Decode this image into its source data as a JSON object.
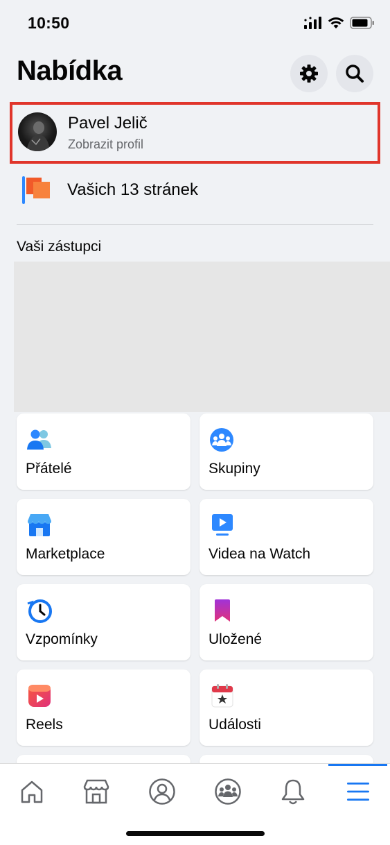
{
  "status_bar": {
    "time": "10:50"
  },
  "header": {
    "title": "Nabídka"
  },
  "profile": {
    "name": "Pavel Jelič",
    "subtitle": "Zobrazit profil"
  },
  "pages": {
    "label": "Vašich 13 stránek"
  },
  "shortcuts": {
    "title": "Vaši zástupci"
  },
  "tiles": [
    {
      "label": "Přátelé",
      "icon": "friends-icon"
    },
    {
      "label": "Skupiny",
      "icon": "groups-icon"
    },
    {
      "label": "Marketplace",
      "icon": "marketplace-icon"
    },
    {
      "label": "Videa na Watch",
      "icon": "watch-icon"
    },
    {
      "label": "Vzpomínky",
      "icon": "memories-icon"
    },
    {
      "label": "Uložené",
      "icon": "saved-icon"
    },
    {
      "label": "Reels",
      "icon": "reels-icon"
    },
    {
      "label": "Události",
      "icon": "events-icon"
    }
  ],
  "bottom_nav": {
    "items": [
      "home-icon",
      "marketplace-icon",
      "profile-icon",
      "groups-icon",
      "notifications-icon",
      "menu-icon"
    ],
    "active": "menu-icon"
  },
  "colors": {
    "accent": "#1877f2",
    "highlight_border": "#e0352b",
    "background": "#f0f2f5"
  }
}
